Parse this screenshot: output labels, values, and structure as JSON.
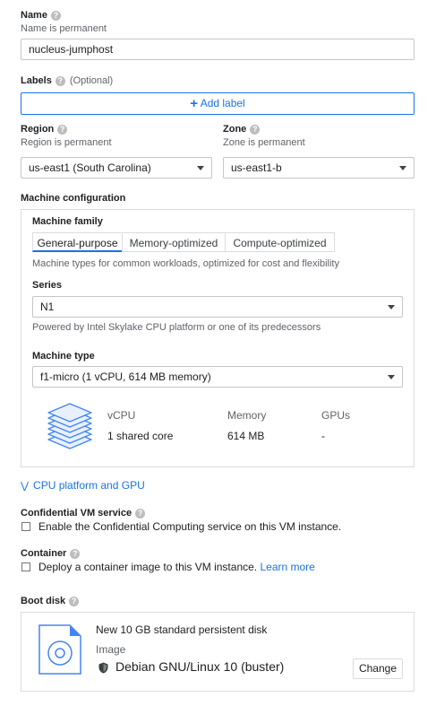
{
  "name": {
    "label": "Name",
    "hint": "Name is permanent",
    "value": "nucleus-jumphost"
  },
  "labels": {
    "label": "Labels",
    "optional": "(Optional)",
    "add_label": "Add label"
  },
  "region": {
    "label": "Region",
    "hint": "Region is permanent",
    "value": "us-east1 (South Carolina)"
  },
  "zone": {
    "label": "Zone",
    "hint": "Zone is permanent",
    "value": "us-east1-b"
  },
  "machine_config": {
    "title": "Machine configuration",
    "family_label": "Machine family",
    "tabs": [
      "General-purpose",
      "Memory-optimized",
      "Compute-optimized"
    ],
    "family_desc": "Machine types for common workloads, optimized for cost and flexibility",
    "series_label": "Series",
    "series_value": "N1",
    "series_desc": "Powered by Intel Skylake CPU platform or one of its predecessors",
    "type_label": "Machine type",
    "type_value": "f1-micro (1 vCPU, 614 MB memory)",
    "specs": {
      "headers": [
        "vCPU",
        "Memory",
        "GPUs"
      ],
      "values": [
        "1 shared core",
        "614 MB",
        "-"
      ]
    }
  },
  "cpu_platform": {
    "label": "CPU platform and GPU"
  },
  "confidential": {
    "label": "Confidential VM service",
    "checkbox": "Enable the Confidential Computing service on this VM instance."
  },
  "container": {
    "label": "Container",
    "checkbox": "Deploy a container image to this VM instance.",
    "learn_more": "Learn more"
  },
  "boot_disk": {
    "label": "Boot disk",
    "disk_desc": "New 10 GB standard persistent disk",
    "image_label": "Image",
    "image_value": "Debian GNU/Linux 10 (buster)",
    "change_button": "Change"
  },
  "colors": {
    "accent": "#1a73e8",
    "border": "#dadce0"
  }
}
